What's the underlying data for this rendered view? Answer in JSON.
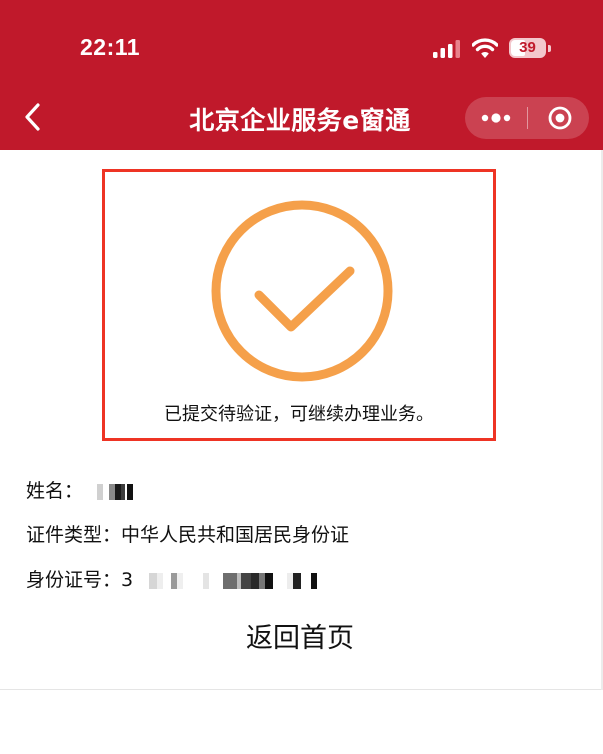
{
  "status_bar": {
    "time": "22:11",
    "battery_level": "39",
    "icons": [
      "signal-icon",
      "wifi-icon",
      "battery-icon"
    ]
  },
  "nav": {
    "title": "北京企业服务e窗通",
    "back_icon": "chevron-left-icon",
    "more_icon": "more-dots-icon",
    "close_icon": "target-circle-icon"
  },
  "result": {
    "icon": "check-circle-icon",
    "message": "已提交待验证，可继续办理业务。",
    "highlight_color": "#ee3424",
    "icon_color": "#f5a04a"
  },
  "info": {
    "name_label": "姓名：",
    "name_value_visible": "",
    "id_type_label": "证件类型：",
    "id_type_value": "中华人民共和国居民身份证",
    "id_number_label": "身份证号：",
    "id_number_visible": "3"
  },
  "actions": {
    "home_label": "返回首页"
  },
  "colors": {
    "header_bg": "#c0192b",
    "text": "#111111",
    "background": "#ffffff"
  }
}
